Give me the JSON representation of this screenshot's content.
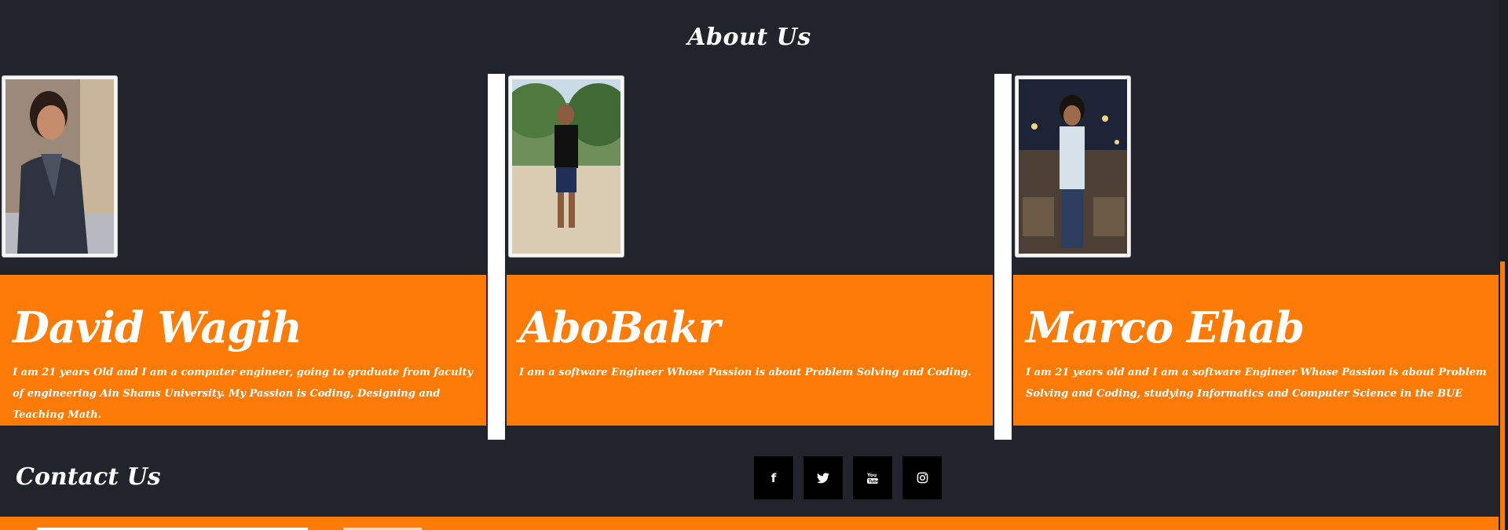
{
  "about": {
    "title": "About Us"
  },
  "members": [
    {
      "name": "David Wagih",
      "bio": "I am 21 years Old and I am a computer engineer, going to graduate from faculty of engineering Ain Shams University. My Passion is Coding, Designing and Teaching Math."
    },
    {
      "name": "AboBakr",
      "bio": "I am a software Engineer Whose Passion is about Problem Solving and Coding."
    },
    {
      "name": "Marco Ehab",
      "bio": "I am 21 years old and I am a software Engineer Whose Passion is about Problem Solving and Coding, studying Informatics and Computer Science in the BUE"
    }
  ],
  "contact": {
    "title": "Contact Us",
    "socials": [
      {
        "icon": "facebook-icon",
        "glyph": "f"
      },
      {
        "icon": "twitter-icon",
        "glyph": "🐦"
      },
      {
        "icon": "youtube-icon",
        "glyph": "▶"
      },
      {
        "icon": "instagram-icon",
        "glyph": "◎"
      }
    ]
  },
  "colors": {
    "background": "#21252b",
    "accent": "#ff7b07",
    "text": "#ffffff",
    "social_bg": "#000000"
  }
}
